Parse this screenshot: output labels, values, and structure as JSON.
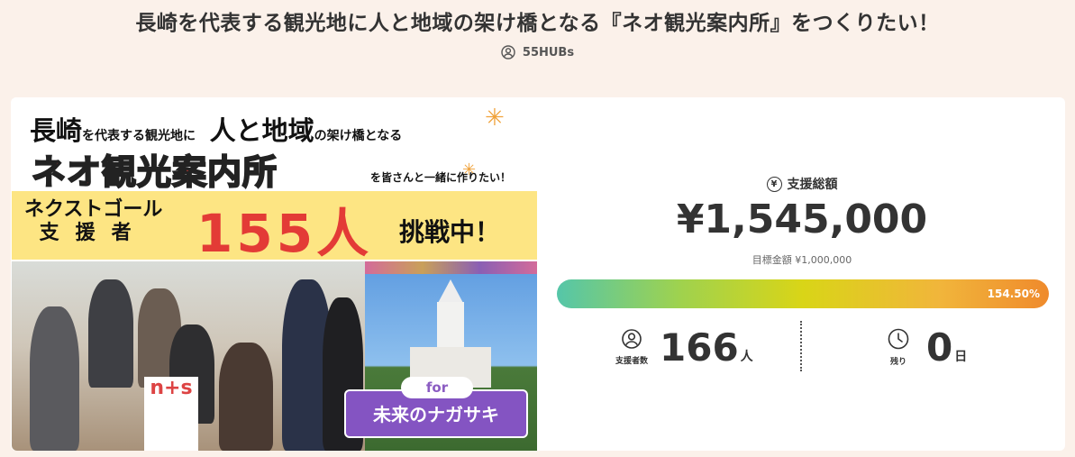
{
  "project": {
    "title": "長崎を代表する観光地に人と地域の架け橋となる『ネオ観光案内所』をつくりたい！",
    "owner": "55HUBs"
  },
  "banner": {
    "line1_big_a": "長崎",
    "line1_small_a": "を代表する観光地に",
    "line1_big_b": "人と地域",
    "line1_small_b": "の架け橋となる",
    "neo": "ネオ観光案内所",
    "neo_sub": "を皆さんと一緒に作りたい！",
    "next_goal": "ネクストゴール",
    "supporters": "支援者",
    "count": "155人",
    "challenge": "挑戦中！",
    "for": "for",
    "future": "未来のナガサキ",
    "ns": "n+s"
  },
  "funding": {
    "total_label": "支援総額",
    "total_amount": "¥1,545,000",
    "goal_text": "目標金額 ¥1,000,000",
    "progress_label": "154.50%",
    "progress_fraction": 1.545
  },
  "stats": {
    "supporters_caption": "支援者数",
    "supporters_count": "166",
    "supporters_unit": "人",
    "remaining_caption": "残り",
    "remaining_count": "0",
    "remaining_unit": "日"
  }
}
